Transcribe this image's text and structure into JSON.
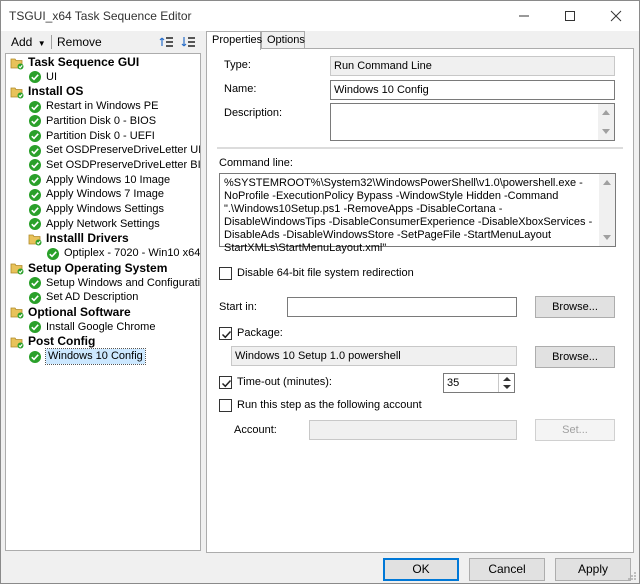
{
  "window": {
    "title": "TSGUI_x64 Task Sequence Editor"
  },
  "toolbar": {
    "add_label": "Add",
    "remove_label": "Remove"
  },
  "tree": [
    {
      "label": "Task Sequence GUI",
      "type": "group",
      "level": 0
    },
    {
      "label": "UI",
      "type": "step",
      "level": 1
    },
    {
      "label": "Install OS",
      "type": "group",
      "level": 0
    },
    {
      "label": "Restart in Windows PE",
      "type": "step",
      "level": 1
    },
    {
      "label": "Partition Disk 0 - BIOS",
      "type": "step",
      "level": 1
    },
    {
      "label": "Partition Disk 0 - UEFI",
      "type": "step",
      "level": 1
    },
    {
      "label": "Set OSDPreserveDriveLetter UEFI",
      "type": "step",
      "level": 1
    },
    {
      "label": "Set OSDPreserveDriveLetter BIOS",
      "type": "step",
      "level": 1
    },
    {
      "label": "Apply Windows 10 Image",
      "type": "step",
      "level": 1
    },
    {
      "label": "Apply Windows 7 Image",
      "type": "step",
      "level": 1
    },
    {
      "label": "Apply Windows Settings",
      "type": "step",
      "level": 1
    },
    {
      "label": "Apply Network Settings",
      "type": "step",
      "level": 1
    },
    {
      "label": "Installl Drivers",
      "type": "group",
      "level": 1
    },
    {
      "label": "Optiplex - 7020 - Win10 x64",
      "type": "step",
      "level": 2
    },
    {
      "label": "Setup Operating System",
      "type": "group",
      "level": 0
    },
    {
      "label": "Setup Windows and Configuration",
      "type": "step",
      "level": 1
    },
    {
      "label": "Set AD Description",
      "type": "step",
      "level": 1
    },
    {
      "label": "Optional Software",
      "type": "group",
      "level": 0
    },
    {
      "label": "Install Google Chrome",
      "type": "step",
      "level": 1
    },
    {
      "label": "Post Config",
      "type": "group",
      "level": 0
    },
    {
      "label": "Windows 10 Config",
      "type": "step",
      "level": 1,
      "selected": true
    }
  ],
  "tabs": {
    "properties": "Properties",
    "options": "Options"
  },
  "props": {
    "type_label": "Type:",
    "type_value": "Run Command Line",
    "name_label": "Name:",
    "name_value": "Windows 10 Config",
    "description_label": "Description:",
    "description_value": "",
    "command_line_label": "Command line:",
    "command_line_value": "%SYSTEMROOT%\\System32\\WindowsPowerShell\\v1.0\\powershell.exe -NoProfile -ExecutionPolicy Bypass -WindowStyle Hidden -Command \".\\Windows10Setup.ps1 -RemoveApps -DisableCortana -DisableWindowsTips -DisableConsumerExperience -DisableXboxServices -DisableAds -DisableWindowsStore -SetPageFile -StartMenuLayout StartXMLs\\StartMenuLayout.xml\"",
    "disable64_label": "Disable 64-bit file system redirection",
    "disable64_checked": false,
    "start_in_label": "Start in:",
    "start_in_value": "",
    "browse_label": "Browse...",
    "package_label": "Package:",
    "package_checked": true,
    "package_value": "Windows 10 Setup 1.0 powershell",
    "timeout_label": "Time-out (minutes):",
    "timeout_checked": true,
    "timeout_value": "35",
    "runas_label": "Run this step as the following account",
    "runas_checked": false,
    "account_label": "Account:",
    "account_value": "",
    "set_label": "Set..."
  },
  "footer": {
    "ok_label": "OK",
    "cancel_label": "Cancel",
    "apply_label": "Apply"
  },
  "colors": {
    "selection": "#cce8ff",
    "check_green": "#2aa02a",
    "folder_yellow": "#e8c25a",
    "accent": "#0078d7"
  }
}
